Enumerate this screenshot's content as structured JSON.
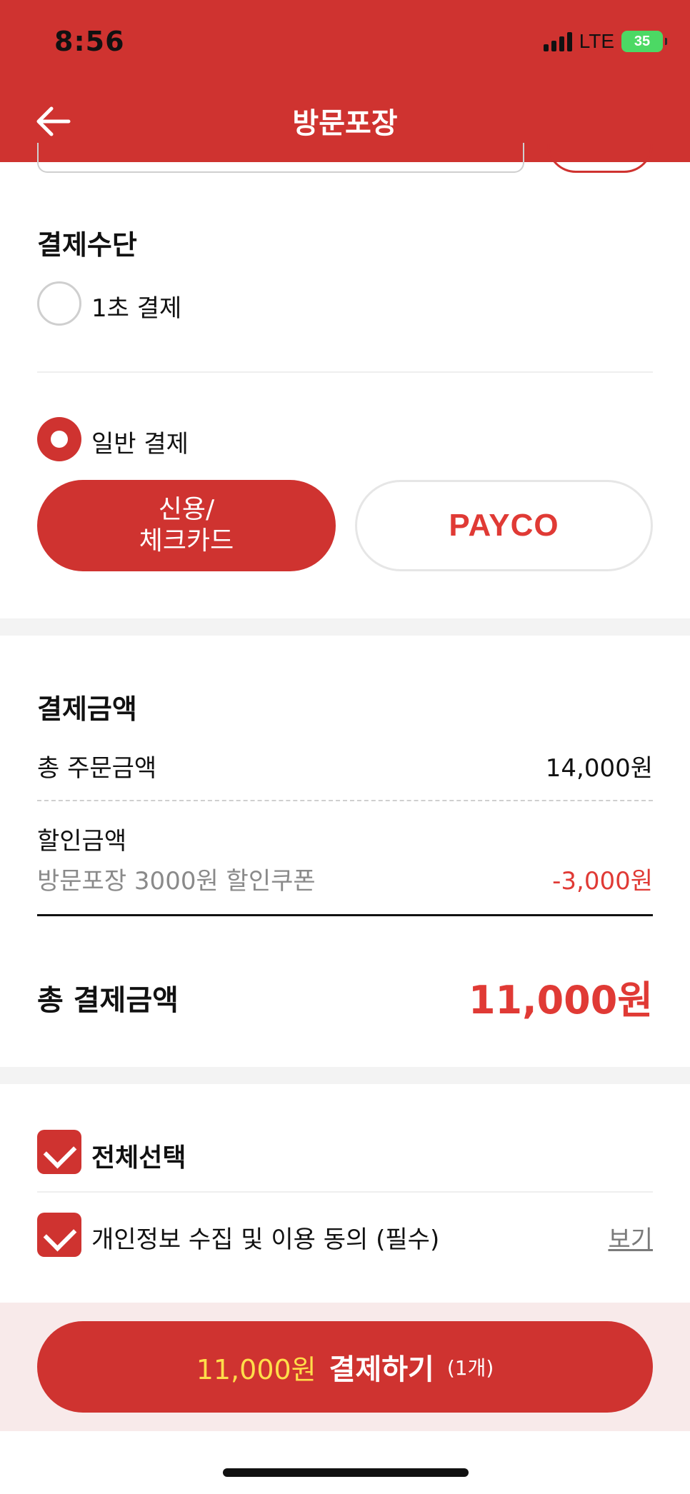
{
  "status_bar": {
    "time": "8:56",
    "network": "LTE",
    "battery": "35"
  },
  "header": {
    "title": "방문포장",
    "back_icon": "arrow-left-icon"
  },
  "payment_method": {
    "title": "결제수단",
    "quick_pay": {
      "label": "1초 결제",
      "selected": false
    },
    "general_pay": {
      "label": "일반 결제",
      "selected": true
    },
    "options": [
      {
        "label": "신용/\n체크카드",
        "selected": true
      },
      {
        "label": "PAYCO",
        "selected": false
      }
    ]
  },
  "payment_amount": {
    "title": "결제금액",
    "order_total_label": "총 주문금액",
    "order_total_value": "14,000원",
    "discount_label": "할인금액",
    "discount_detail": "방문포장 3000원 할인쿠폰",
    "discount_value": "-3,000원",
    "final_label": "총 결제금액",
    "final_value": "11,000원"
  },
  "agreements": {
    "select_all": {
      "label": "전체선택",
      "checked": true
    },
    "items": [
      {
        "label": "개인정보 수집 및 이용 동의 (필수)",
        "checked": true,
        "link": "보기"
      }
    ]
  },
  "checkout": {
    "amount": "11,000원",
    "label": "결제하기",
    "count": "(1개)"
  },
  "colors": {
    "brand": "#cf3330",
    "accent_red": "#e03a35",
    "highlight": "#ffde4a"
  }
}
